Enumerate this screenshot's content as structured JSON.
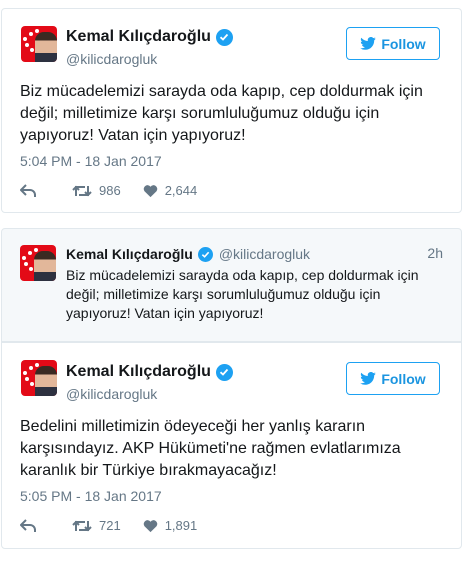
{
  "tweets": [
    {
      "author": "Kemal Kılıçdaroğlu",
      "handle": "@kilicdarogluk",
      "follow_label": "Follow",
      "text": "Biz mücadelemizi sarayda oda kapıp, cep doldurmak için değil; milletimize karşı sorumluluğumuz olduğu için yapıyoruz! Vatan için yapıyoruz!",
      "timestamp": "5:04 PM - 18 Jan 2017",
      "retweets": "986",
      "likes": "2,644"
    },
    {
      "author": "Kemal Kılıçdaroğlu",
      "handle": "@kilicdarogluk",
      "relative_time": "2h",
      "text": "Biz mücadelemizi sarayda oda kapıp, cep doldurmak için değil; milletimize karşı sorumluluğumuz olduğu için yapıyoruz! Vatan için yapıyoruz!"
    },
    {
      "author": "Kemal Kılıçdaroğlu",
      "handle": "@kilicdarogluk",
      "follow_label": "Follow",
      "text": "Bedelini milletimizin ödeyeceği her yanlış kararın karşısındayız. AKP Hükümeti'ne rağmen evlatlarımıza karanlık bir Türkiye bırakmayacağız!",
      "timestamp": "5:05 PM - 18 Jan 2017",
      "retweets": "721",
      "likes": "1,891"
    }
  ],
  "icons": {
    "verified": "verified-badge-icon",
    "follow": "twitter-bird-icon",
    "reply": "reply-icon",
    "retweet": "retweet-icon",
    "like": "heart-icon"
  },
  "colors": {
    "accent": "#1da1f2",
    "text": "#14171a",
    "muted": "#657786",
    "border": "#e1e8ed",
    "avatar_red": "#e30a17"
  }
}
